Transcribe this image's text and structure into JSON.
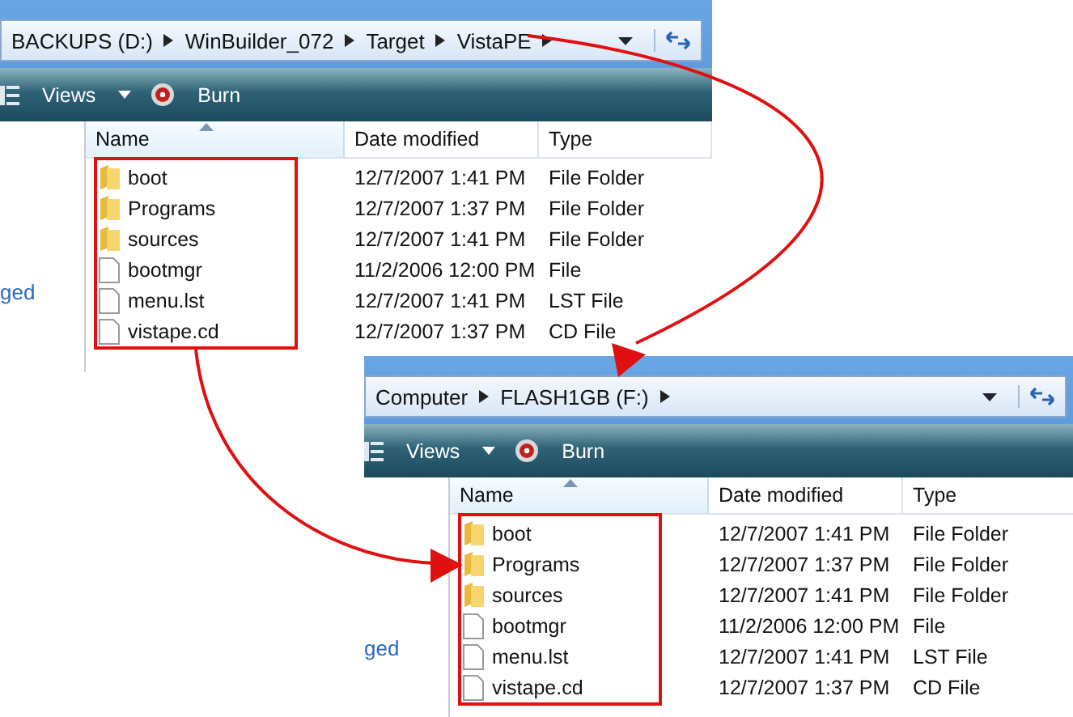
{
  "windows": [
    {
      "address": {
        "crumbs": [
          "BACKUPS (D:)",
          "WinBuilder_072",
          "Target",
          "VistaPE"
        ]
      },
      "toolbar": {
        "views": "Views",
        "burn": "Burn"
      },
      "nav_pane": {
        "link": "ged"
      },
      "columns": [
        {
          "label": "Name",
          "sorted": true
        },
        {
          "label": "Date modified",
          "sorted": false
        },
        {
          "label": "Type",
          "sorted": false
        }
      ],
      "rows": [
        {
          "name": "boot",
          "date": "12/7/2007 1:41 PM",
          "type": "File Folder",
          "kind": "folder"
        },
        {
          "name": "Programs",
          "date": "12/7/2007 1:37 PM",
          "type": "File Folder",
          "kind": "folder"
        },
        {
          "name": "sources",
          "date": "12/7/2007 1:41 PM",
          "type": "File Folder",
          "kind": "folder"
        },
        {
          "name": "bootmgr",
          "date": "11/2/2006 12:00 PM",
          "type": "File",
          "kind": "file"
        },
        {
          "name": "menu.lst",
          "date": "12/7/2007 1:41 PM",
          "type": "LST File",
          "kind": "file"
        },
        {
          "name": "vistape.cd",
          "date": "12/7/2007 1:37 PM",
          "type": "CD File",
          "kind": "file"
        }
      ]
    },
    {
      "address": {
        "crumbs": [
          "Computer",
          "FLASH1GB (F:)"
        ]
      },
      "toolbar": {
        "views": "Views",
        "burn": "Burn"
      },
      "nav_pane": {
        "link": "ged"
      },
      "columns": [
        {
          "label": "Name",
          "sorted": true
        },
        {
          "label": "Date modified",
          "sorted": false
        },
        {
          "label": "Type",
          "sorted": false
        }
      ],
      "rows": [
        {
          "name": "boot",
          "date": "12/7/2007 1:41 PM",
          "type": "File Folder",
          "kind": "folder"
        },
        {
          "name": "Programs",
          "date": "12/7/2007 1:37 PM",
          "type": "File Folder",
          "kind": "folder"
        },
        {
          "name": "sources",
          "date": "12/7/2007 1:41 PM",
          "type": "File Folder",
          "kind": "folder"
        },
        {
          "name": "bootmgr",
          "date": "11/2/2006 12:00 PM",
          "type": "File",
          "kind": "file"
        },
        {
          "name": "menu.lst",
          "date": "12/7/2007 1:41 PM",
          "type": "LST File",
          "kind": "file"
        },
        {
          "name": "vistape.cd",
          "date": "12/7/2007 1:37 PM",
          "type": "CD File",
          "kind": "file"
        }
      ]
    }
  ]
}
